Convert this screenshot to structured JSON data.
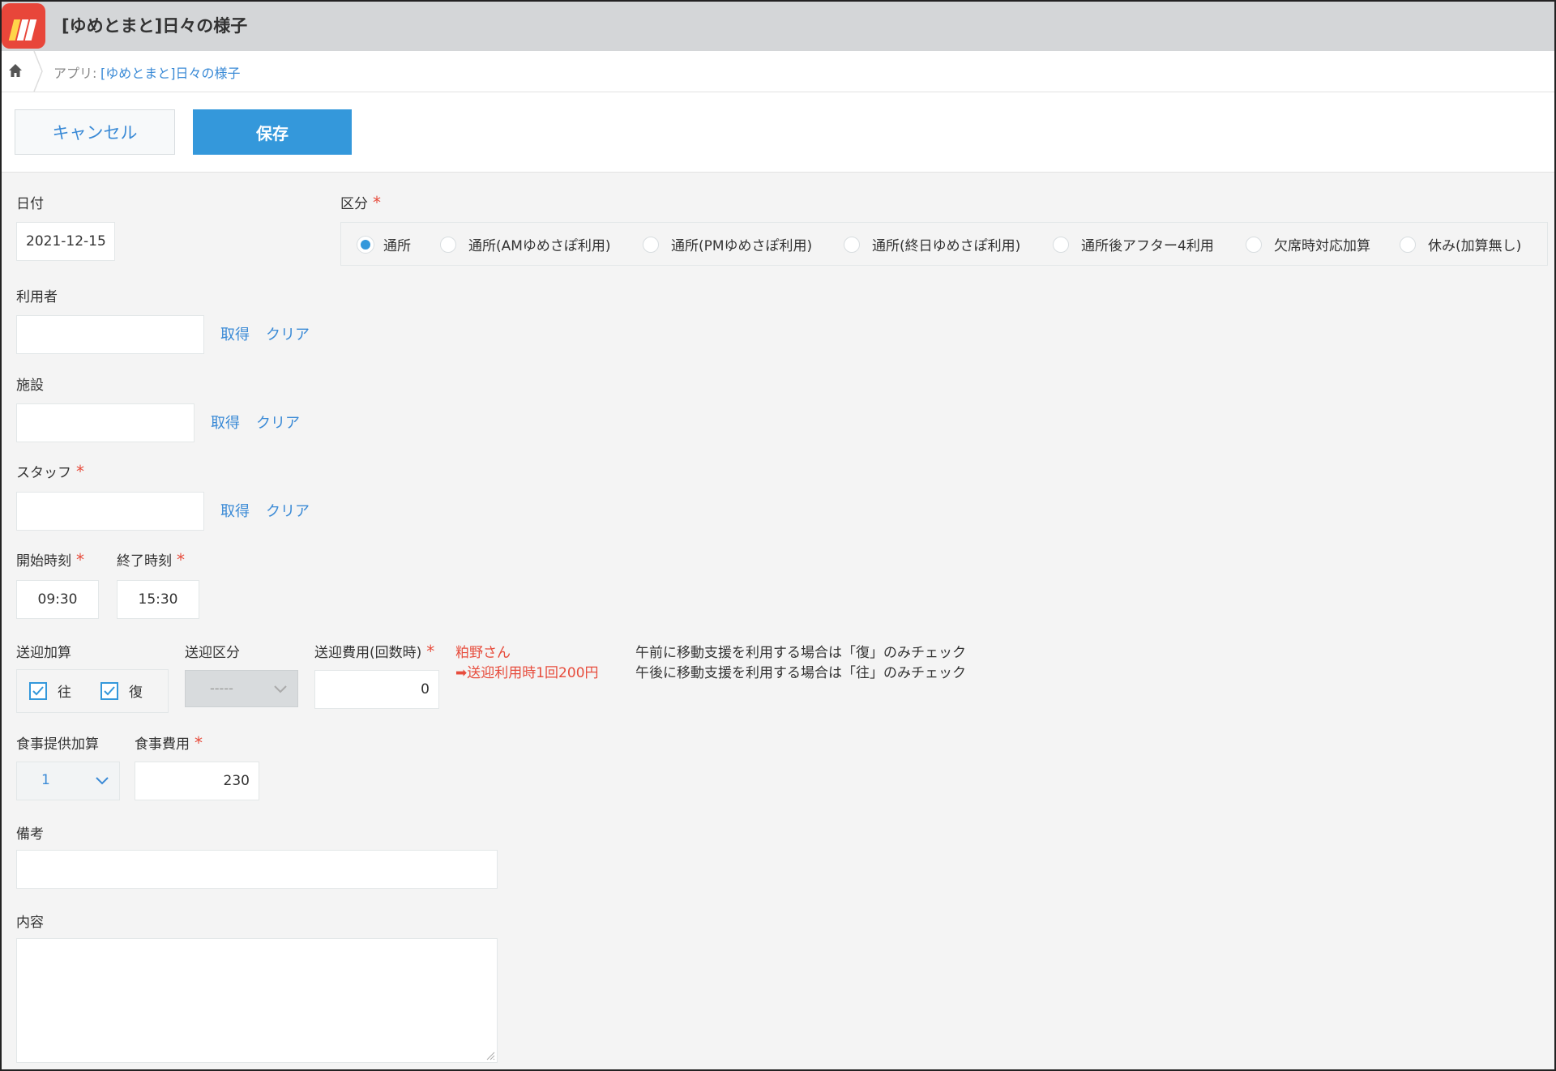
{
  "header": {
    "title": "[ゆめとまと]日々の様子"
  },
  "breadcrumb": {
    "prefix": "アプリ:",
    "app_link": "[ゆめとまと]日々の様子"
  },
  "toolbar": {
    "cancel_label": "キャンセル",
    "save_label": "保存"
  },
  "form": {
    "date": {
      "label": "日付",
      "value": "2021-12-15"
    },
    "category": {
      "label": "区分",
      "options": [
        "通所",
        "通所(AMゆめさぽ利用)",
        "通所(PMゆめさぽ利用)",
        "通所(終日ゆめさぽ利用)",
        "通所後アフター4利用",
        "欠席時対応加算",
        "休み(加算無し)"
      ],
      "selected": "通所"
    },
    "user": {
      "label": "利用者",
      "fetch_label": "取得",
      "clear_label": "クリア",
      "value": ""
    },
    "facility": {
      "label": "施設",
      "fetch_label": "取得",
      "clear_label": "クリア",
      "value": ""
    },
    "staff": {
      "label": "スタッフ",
      "fetch_label": "取得",
      "clear_label": "クリア",
      "value": ""
    },
    "start_time": {
      "label": "開始時刻",
      "value": "09:30"
    },
    "end_time": {
      "label": "終了時刻",
      "value": "15:30"
    },
    "transport_add": {
      "label": "送迎加算",
      "options": [
        {
          "label": "往",
          "checked": true
        },
        {
          "label": "復",
          "checked": true
        }
      ]
    },
    "transport_type": {
      "label": "送迎区分",
      "value": "-----"
    },
    "transport_fee": {
      "label": "送迎費用(回数時)",
      "value": "0"
    },
    "transport_note_red": [
      "粕野さん",
      "➡送迎利用時1回200円"
    ],
    "transport_note": [
      "午前に移動支援を利用する場合は「復」のみチェック",
      "午後に移動支援を利用する場合は「往」のみチェック"
    ],
    "meal_add": {
      "label": "食事提供加算",
      "value": "1"
    },
    "meal_fee": {
      "label": "食事費用",
      "value": "230"
    },
    "remarks": {
      "label": "備考",
      "value": ""
    },
    "content": {
      "label": "内容",
      "value": ""
    },
    "required_mark": "*"
  },
  "colors": {
    "accent": "#3498db",
    "required": "#e74c3c",
    "link": "#3a8ad6"
  }
}
